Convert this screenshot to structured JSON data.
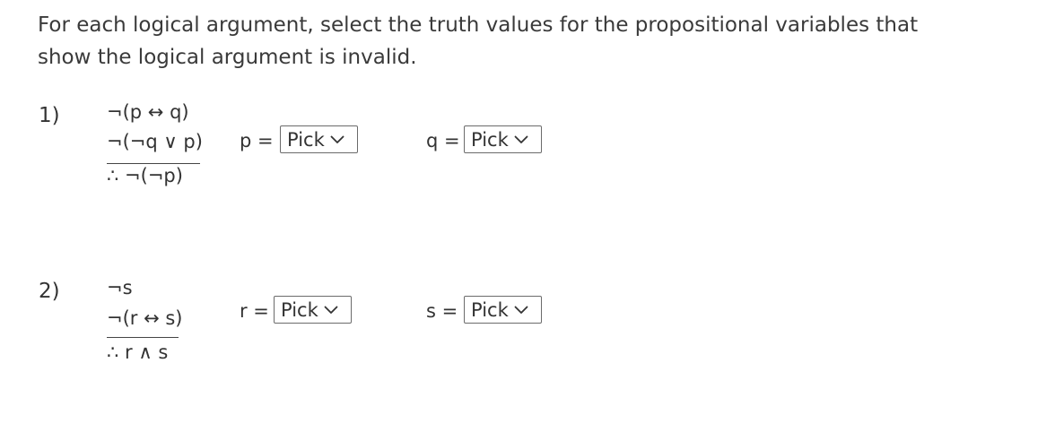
{
  "instructions": {
    "line1": "For each logical argument, select the truth values for the propositional variables that",
    "line2": "show the logical argument is invalid."
  },
  "problems": [
    {
      "number": "1)",
      "premises": [
        "¬(p ↔ q)",
        "¬(¬q ∨ p)"
      ],
      "conclusion": "∴ ¬(¬p)",
      "variables": [
        {
          "label": "p =",
          "selected": "Pick"
        },
        {
          "label": "q =",
          "selected": "Pick"
        }
      ]
    },
    {
      "number": "2)",
      "premises": [
        "¬s",
        "¬(r ↔ s)"
      ],
      "conclusion": "∴ r ∧ s",
      "variables": [
        {
          "label": "r =",
          "selected": "Pick"
        },
        {
          "label": "s =",
          "selected": "Pick"
        }
      ]
    }
  ]
}
